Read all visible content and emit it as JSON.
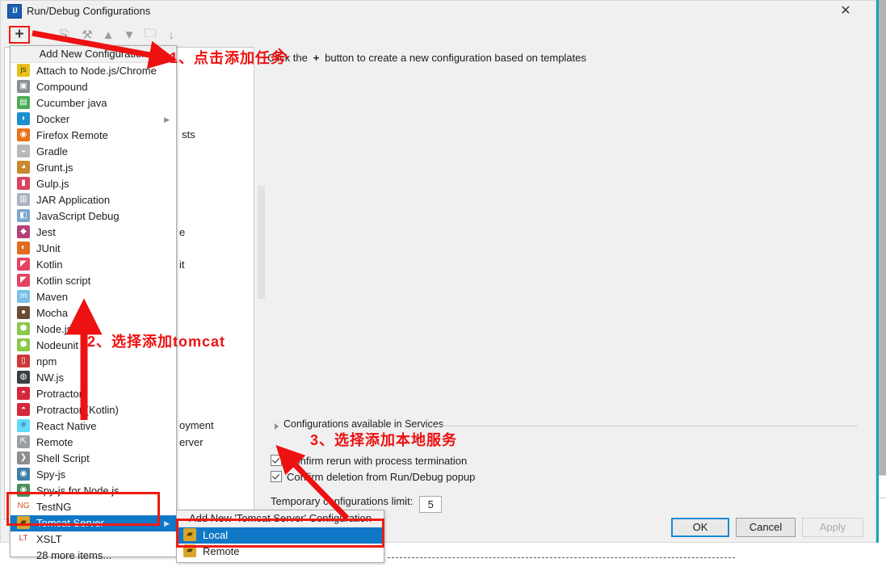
{
  "dialog": {
    "title": "Run/Debug Configurations",
    "app_icon": "intellij-idea-icon",
    "close_icon": "✕"
  },
  "toolbar": {
    "add": "+",
    "remove": "−",
    "copy": "⎘",
    "edit_templates": "⚒",
    "move_up": "▲",
    "move_down": "▼",
    "folder": "🗀",
    "sort": "↓"
  },
  "left_panel": {
    "fragments": {
      "sts": "sts",
      "e": "e",
      "it": "it",
      "deployment": "oyment",
      "server": "erver"
    }
  },
  "right_panel": {
    "hint_prefix": "Click the",
    "hint_plus": "+",
    "hint_suffix": "button to create a new configuration based on templates",
    "services_label": "Configurations available in Services",
    "checkbox_rerun": "Confirm rerun with process termination",
    "checkbox_delete": "Confirm deletion from Run/Debug popup",
    "temp_limit_label": "Temporary configurations limit:",
    "temp_limit_value": "5"
  },
  "buttons": {
    "ok": "OK",
    "cancel": "Cancel",
    "apply": "Apply"
  },
  "menu": {
    "header": "Add New Configuration",
    "items": [
      {
        "label": "Attach to Node.js/Chrome",
        "icon": "js",
        "icon_bg": "#e8c21a",
        "icon_fg": "#3b3b00",
        "submenu": false
      },
      {
        "label": "Compound",
        "icon": "▣",
        "icon_bg": "#8a8f94",
        "icon_fg": "#ffffff",
        "submenu": false
      },
      {
        "label": "Cucumber java",
        "icon": "▤",
        "icon_bg": "#4aab52",
        "icon_fg": "#ffffff",
        "submenu": false
      },
      {
        "label": "Docker",
        "icon": "◗",
        "icon_bg": "#1d8fd1",
        "icon_fg": "#ffffff",
        "submenu": true
      },
      {
        "label": "Firefox Remote",
        "icon": "◉",
        "icon_bg": "#e8711a",
        "icon_fg": "#ffffff",
        "submenu": false
      },
      {
        "label": "Gradle",
        "icon": "◒",
        "icon_bg": "#b8b8b8",
        "icon_fg": "#ffffff",
        "submenu": false
      },
      {
        "label": "Grunt.js",
        "icon": "◕",
        "icon_bg": "#c8892c",
        "icon_fg": "#ffffff",
        "submenu": false
      },
      {
        "label": "Gulp.js",
        "icon": "▮",
        "icon_bg": "#d9455e",
        "icon_fg": "#ffffff",
        "submenu": false
      },
      {
        "label": "JAR Application",
        "icon": "▥",
        "icon_bg": "#aab4c0",
        "icon_fg": "#ffffff",
        "submenu": false
      },
      {
        "label": "JavaScript Debug",
        "icon": "◧",
        "icon_bg": "#7aa7cc",
        "icon_fg": "#ffffff",
        "submenu": false
      },
      {
        "label": "Jest",
        "icon": "◆",
        "icon_bg": "#b5417a",
        "icon_fg": "#ffffff",
        "submenu": false
      },
      {
        "label": "JUnit",
        "icon": "◐",
        "icon_bg": "#e06c1f",
        "icon_fg": "#ffffff",
        "submenu": false
      },
      {
        "label": "Kotlin",
        "icon": "◤",
        "icon_bg": "#e24462",
        "icon_fg": "#ffffff",
        "submenu": false
      },
      {
        "label": "Kotlin script",
        "icon": "◤",
        "icon_bg": "#e24462",
        "icon_fg": "#ffffff",
        "submenu": false
      },
      {
        "label": "Maven",
        "icon": "m",
        "icon_bg": "#79c0e8",
        "icon_fg": "#ffffff",
        "submenu": false
      },
      {
        "label": "Mocha",
        "icon": "●",
        "icon_bg": "#6b4a35",
        "icon_fg": "#ffffff",
        "submenu": false
      },
      {
        "label": "Node.js",
        "icon": "⬢",
        "icon_bg": "#8cc84b",
        "icon_fg": "#ffffff",
        "submenu": false
      },
      {
        "label": "Nodeunit",
        "icon": "⬢",
        "icon_bg": "#8cc84b",
        "icon_fg": "#ffffff",
        "submenu": false
      },
      {
        "label": "npm",
        "icon": "▯",
        "icon_bg": "#cb3837",
        "icon_fg": "#ffffff",
        "submenu": false
      },
      {
        "label": "NW.js",
        "icon": "◍",
        "icon_bg": "#3a3f45",
        "icon_fg": "#ffffff",
        "submenu": false
      },
      {
        "label": "Protractor",
        "icon": "◓",
        "icon_bg": "#d6283c",
        "icon_fg": "#ffffff",
        "submenu": false
      },
      {
        "label": "Protractor (Kotlin)",
        "icon": "◓",
        "icon_bg": "#d6283c",
        "icon_fg": "#ffffff",
        "submenu": false
      },
      {
        "label": "React Native",
        "icon": "⚛",
        "icon_bg": "#61dafb",
        "icon_fg": "#1d3a48",
        "submenu": false
      },
      {
        "label": "Remote",
        "icon": "⇱",
        "icon_bg": "#9aa0a6",
        "icon_fg": "#ffffff",
        "submenu": false
      },
      {
        "label": "Shell Script",
        "icon": "❯",
        "icon_bg": "#8d8d8d",
        "icon_fg": "#ffffff",
        "submenu": false
      },
      {
        "label": "Spy-js",
        "icon": "◉",
        "icon_bg": "#3f7fa6",
        "icon_fg": "#ffffff",
        "submenu": false
      },
      {
        "label": "Spy-js for Node.js",
        "icon": "◉",
        "icon_bg": "#4a8f5a",
        "icon_fg": "#ffffff",
        "submenu": false
      },
      {
        "label": "TestNG",
        "icon": "NG",
        "icon_bg": "#ffffff",
        "icon_fg": "#c8541a",
        "submenu": false
      },
      {
        "label": "Tomcat Server",
        "icon": "▰",
        "icon_bg": "#d8a62a",
        "icon_fg": "#5a3c00",
        "submenu": true,
        "selected": true
      },
      {
        "label": "XSLT",
        "icon": "LT",
        "icon_bg": "#ffffff",
        "icon_fg": "#cc3333",
        "submenu": false
      },
      {
        "label": "28 more items...",
        "icon": "",
        "icon_bg": "transparent",
        "icon_fg": "transparent",
        "submenu": false,
        "more": true
      }
    ]
  },
  "submenu": {
    "header": "Add New 'Tomcat Server' Configuration",
    "items": [
      {
        "label": "Local",
        "icon": "▰",
        "icon_bg": "#d8a62a",
        "icon_fg": "#5a3c00",
        "selected": true
      },
      {
        "label": "Remote",
        "icon": "▰",
        "icon_bg": "#d8a62a",
        "icon_fg": "#5a3c00",
        "selected": false
      }
    ]
  },
  "annotations": {
    "step1": "1、点击添加任务",
    "step2": "2、选择添加tomcat",
    "step3": "3、选择添加本地服务",
    "color": "#ee1111"
  }
}
